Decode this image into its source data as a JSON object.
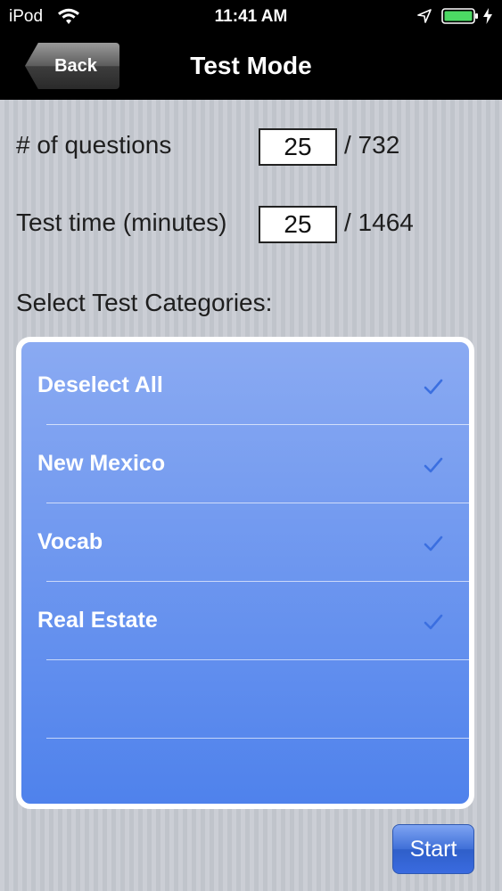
{
  "status_bar": {
    "carrier": "iPod",
    "time": "11:41 AM"
  },
  "nav": {
    "back_label": "Back",
    "title": "Test Mode"
  },
  "form": {
    "questions_label": "# of questions",
    "questions_value": "25",
    "questions_total": "/ 732",
    "time_label": "Test time (minutes)",
    "time_value": "25",
    "time_total": "/ 1464"
  },
  "categories": {
    "heading": "Select Test Categories:",
    "items": [
      {
        "label": "Deselect All",
        "checked": true
      },
      {
        "label": "New Mexico",
        "checked": true
      },
      {
        "label": "Vocab",
        "checked": true
      },
      {
        "label": "Real Estate",
        "checked": true
      }
    ]
  },
  "start_label": "Start",
  "colors": {
    "accent": "#4f82ec",
    "check": "#3b6fe0"
  }
}
